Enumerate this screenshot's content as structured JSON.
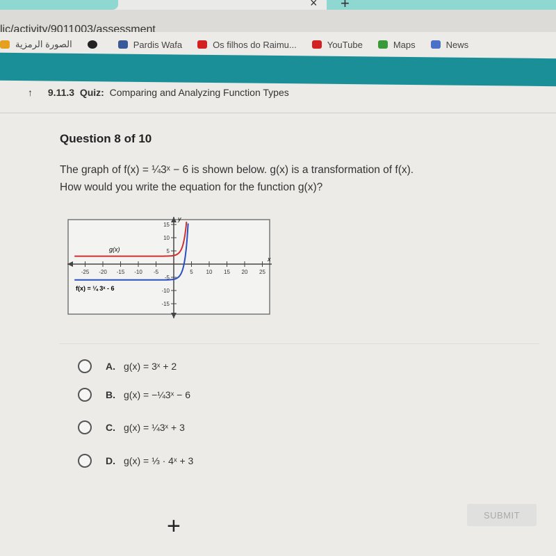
{
  "browser": {
    "url": "lic/activity/9011003/assessment",
    "bookmarks": [
      {
        "label": "الصورة الرمزية",
        "icon": "pinwheel-icon",
        "color": "#e5a020"
      },
      {
        "label": "",
        "icon": "globe-icon",
        "color": "#222"
      },
      {
        "label": "Pardis Wafa",
        "icon": "facebook-icon",
        "color": "#3b5998"
      },
      {
        "label": "Os filhos do Raimu...",
        "icon": "youtube-icon",
        "color": "#d32020"
      },
      {
        "label": "YouTube",
        "icon": "youtube-icon",
        "color": "#d32020"
      },
      {
        "label": "Maps",
        "icon": "maps-pin-icon",
        "color": "#3a9a3a"
      },
      {
        "label": "News",
        "icon": "news-icon",
        "color": "#4a70c8"
      }
    ]
  },
  "quiz": {
    "number": "9.11.3",
    "kind": "Quiz:",
    "title": "Comparing and Analyzing Function Types",
    "accent": "#1a8f98"
  },
  "question": {
    "counter": "Question 8 of 10",
    "line1_pre": "The graph of ",
    "line1_func": "f(x) = ¼3ˣ − 6",
    "line1_post": " is shown below. g(x) is a transformation of f(x).",
    "line2": "How would you write the equation for the function g(x)?"
  },
  "graph": {
    "x_ticks": [
      "-25",
      "-20",
      "-15",
      "-10",
      "-5",
      "5",
      "10",
      "15",
      "20",
      "25"
    ],
    "y_ticks": [
      "15",
      "10",
      "5",
      "-5",
      "-10",
      "-15"
    ],
    "x_axis_label": "x",
    "y_axis_label": "y",
    "g_label": "g(x)",
    "f_label": "f(x) = ¼ 3ˣ - 6",
    "f_color": "#2a4fc0",
    "g_color": "#d03030"
  },
  "choices": [
    {
      "letter": "A.",
      "text": "g(x) = 3ˣ + 2"
    },
    {
      "letter": "B.",
      "text": "g(x) = −¼3ˣ − 6"
    },
    {
      "letter": "C.",
      "text": "g(x) = ¼3ˣ + 3"
    },
    {
      "letter": "D.",
      "text": "g(x) = ⅓ · 4ˣ + 3"
    }
  ],
  "submit_label": "SUBMIT",
  "plus_label": "+"
}
